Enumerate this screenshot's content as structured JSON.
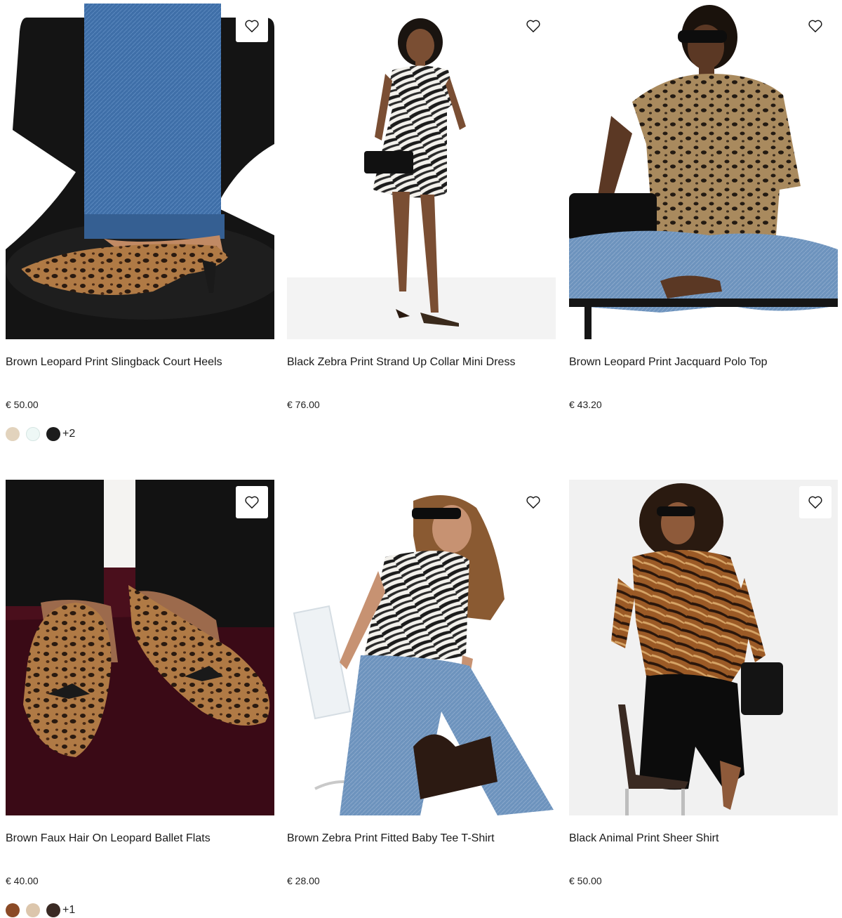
{
  "products": [
    {
      "title": "Brown Leopard Print Slingback Court Heels",
      "price": "€ 50.00",
      "image": "leopard-slingback-heels-photo",
      "swatches": [
        "#e2d3bd",
        "#eef8f6",
        "#1c1c1c"
      ],
      "more": "+2"
    },
    {
      "title": "Black Zebra Print Strand Up Collar Mini Dress",
      "price": "€ 76.00",
      "image": "zebra-mini-dress-photo"
    },
    {
      "title": "Brown Leopard Print Jacquard Polo Top",
      "price": "€ 43.20",
      "image": "leopard-polo-top-photo"
    },
    {
      "title": "Brown Faux Hair On Leopard Ballet Flats",
      "price": "€ 40.00",
      "image": "leopard-ballet-flats-photo",
      "swatches": [
        "#8b4a26",
        "#dcc6ac",
        "#3a2a24"
      ],
      "more": "+1"
    },
    {
      "title": "Brown Zebra Print Fitted Baby Tee T-Shirt",
      "price": "€ 28.00",
      "image": "zebra-baby-tee-photo"
    },
    {
      "title": "Black Animal Print Sheer Shirt",
      "price": "€ 50.00",
      "image": "animal-print-sheer-shirt-photo"
    }
  ],
  "icons": {
    "favourite": "heart-outline-icon"
  }
}
